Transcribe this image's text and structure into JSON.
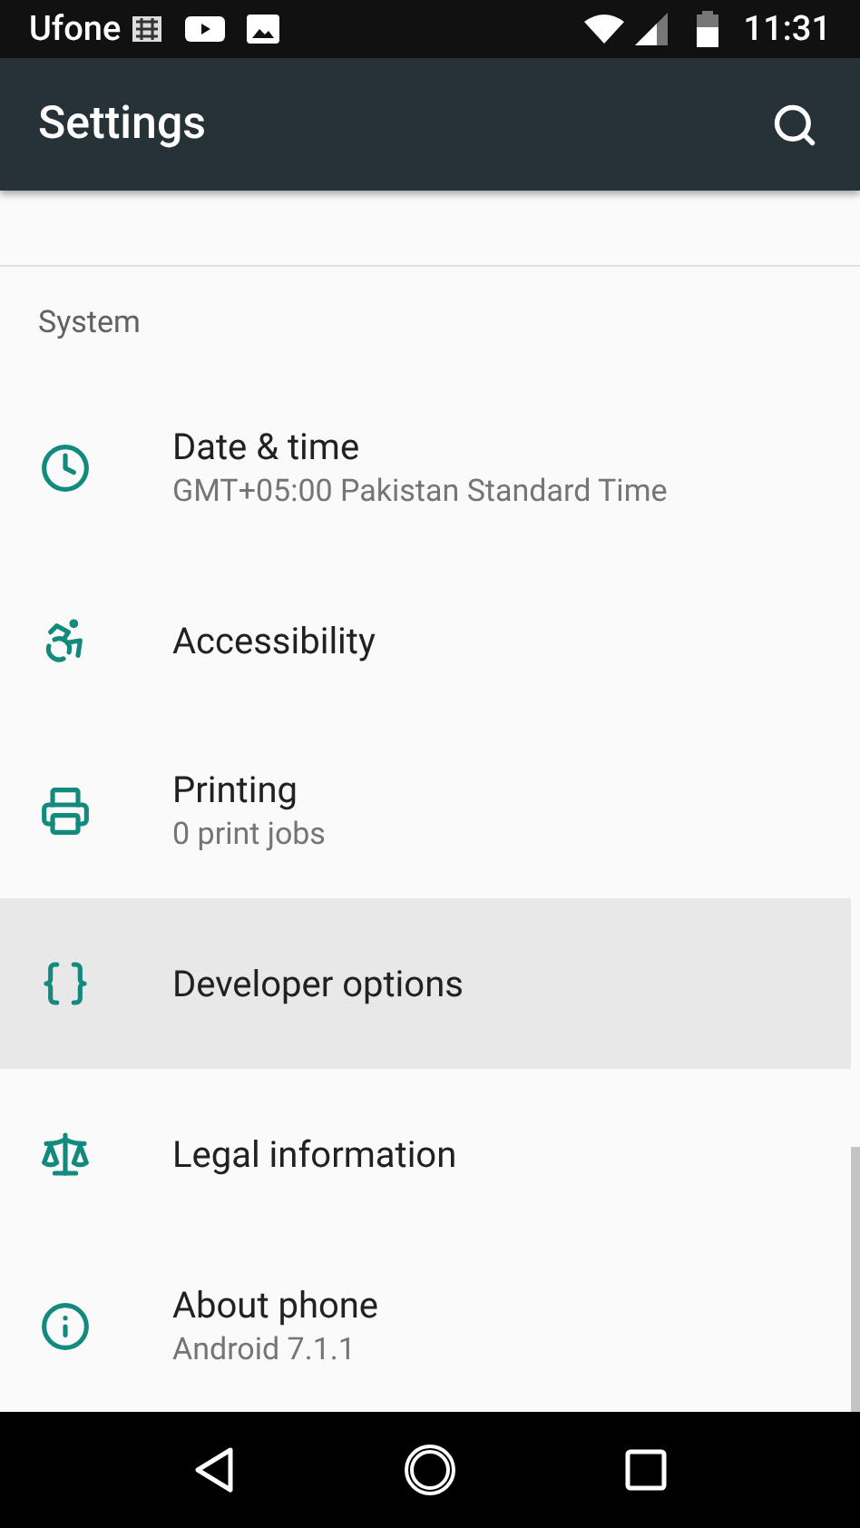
{
  "status_bar": {
    "carrier": "Ufone",
    "time": "11:31"
  },
  "app_bar": {
    "title": "Settings"
  },
  "section": {
    "header": "System"
  },
  "items": [
    {
      "title": "Date & time",
      "subtitle": "GMT+05:00 Pakistan Standard Time",
      "highlighted": false
    },
    {
      "title": "Accessibility",
      "highlighted": false
    },
    {
      "title": "Printing",
      "subtitle": "0 print jobs",
      "highlighted": false
    },
    {
      "title": "Developer options",
      "highlighted": true
    },
    {
      "title": "Legal information",
      "highlighted": false
    },
    {
      "title": "About phone",
      "subtitle": "Android 7.1.1",
      "highlighted": false
    }
  ]
}
